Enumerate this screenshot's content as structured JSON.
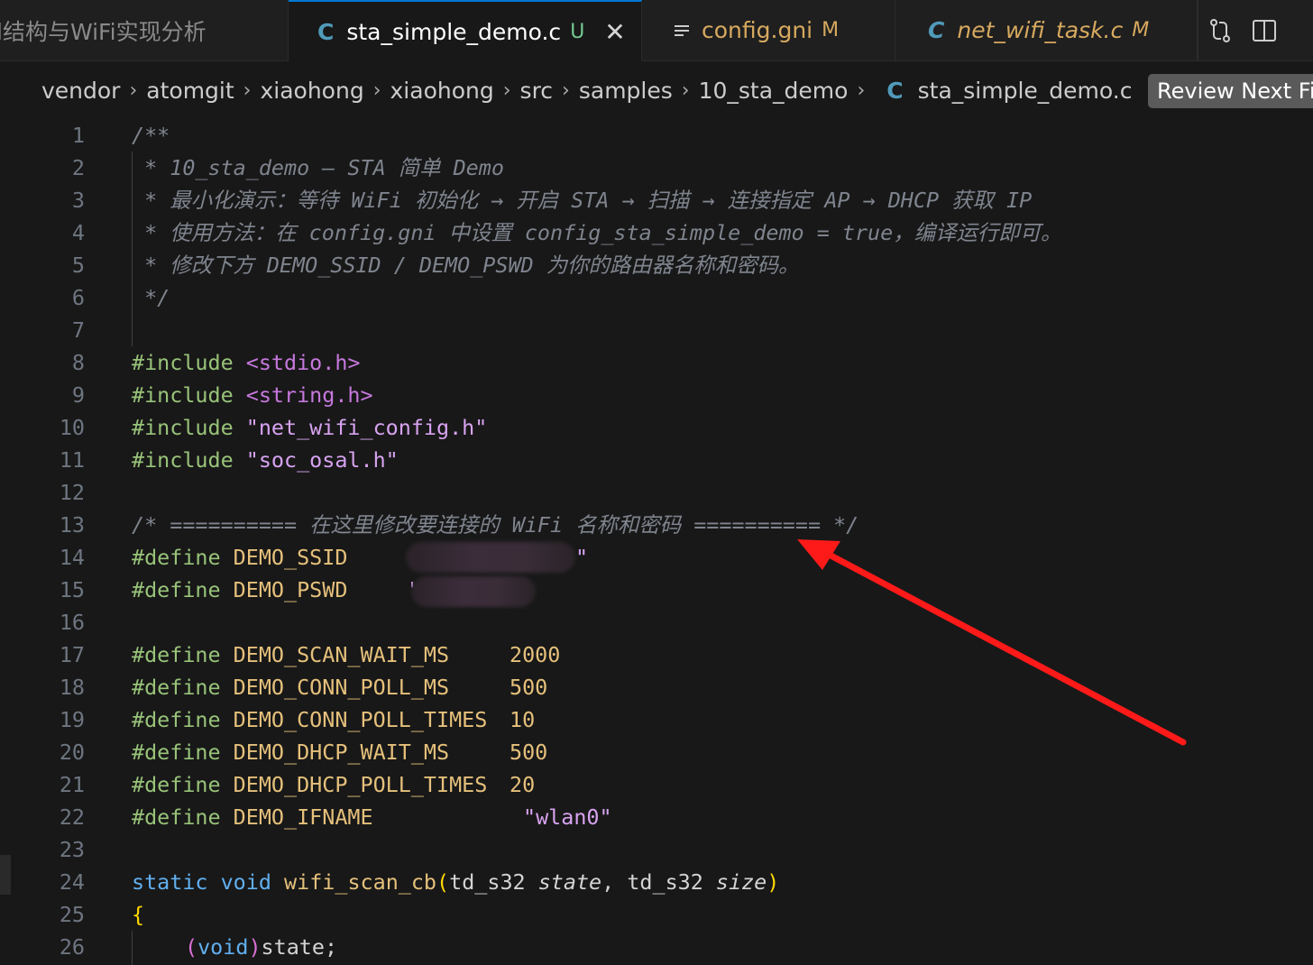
{
  "tabs": [
    {
      "label": "l结构与WiFi实现分析",
      "icon": "",
      "mark": ""
    },
    {
      "label": "sta_simple_demo.c",
      "icon": "C",
      "mark": "U",
      "close": "✕"
    },
    {
      "label": "config.gni",
      "icon": "lines-icon",
      "mark": "M"
    },
    {
      "label": "net_wifi_task.c",
      "icon": "C",
      "mark": "M"
    }
  ],
  "breadcrumb": {
    "items": [
      "vendor",
      "atomgit",
      "xiaohong",
      "xiaohong",
      "src",
      "samples",
      "10_sta_demo"
    ],
    "file_icon": "C",
    "file": "sta_simple_demo.c",
    "sep": "›"
  },
  "review_button": "Review Next File",
  "editor": {
    "line_numbers": [
      "1",
      "2",
      "3",
      "4",
      "5",
      "6",
      "7",
      "8",
      "9",
      "10",
      "11",
      "12",
      "13",
      "14",
      "15",
      "16",
      "17",
      "18",
      "19",
      "20",
      "21",
      "22",
      "23",
      "24",
      "25",
      "26"
    ],
    "comment": [
      "/**",
      " * 10_sta_demo — STA 简单 Demo",
      " * 最小化演示：等待 WiFi 初始化 → 开启 STA → 扫描 → 连接指定 AP → DHCP 获取 IP",
      " * 使用方法：在 config.gni 中设置 config_sta_simple_demo = true，编译运行即可。",
      " * 修改下方 DEMO_SSID / DEMO_PSWD 为你的路由器名称和密码。",
      " */"
    ],
    "includes": [
      {
        "kw": "#include",
        "file": "<stdio.h>"
      },
      {
        "kw": "#include",
        "file": "<string.h>"
      },
      {
        "kw": "#include",
        "file": "\"net_wifi_config.h\""
      },
      {
        "kw": "#include",
        "file": "\"soc_osal.h\""
      }
    ],
    "banner_comment": "/* ========== 在这里修改要连接的 WiFi 名称和密码 ========== */",
    "defines_secret": [
      {
        "kw": "#define",
        "name": "DEMO_SSID",
        "tail": "\""
      },
      {
        "kw": "#define",
        "name": "DEMO_PSWD",
        "tail": "'"
      }
    ],
    "defines": [
      {
        "kw": "#define",
        "name": "DEMO_SCAN_WAIT_MS",
        "value": "2000"
      },
      {
        "kw": "#define",
        "name": "DEMO_CONN_POLL_MS",
        "value": "500"
      },
      {
        "kw": "#define",
        "name": "DEMO_CONN_POLL_TIMES",
        "value": "10"
      },
      {
        "kw": "#define",
        "name": "DEMO_DHCP_WAIT_MS",
        "value": "500"
      },
      {
        "kw": "#define",
        "name": "DEMO_DHCP_POLL_TIMES",
        "value": "20"
      },
      {
        "kw": "#define",
        "name": "DEMO_IFNAME",
        "value": "\"wlan0\""
      }
    ],
    "func_sig": {
      "static": "static",
      "void": "void",
      "name": "wifi_scan_cb",
      "open": "(",
      "t1": "td_s32",
      "p1": "state",
      "comma": ",",
      "t2": "td_s32",
      "p2": "size",
      "close": ")"
    },
    "brace_open": "{",
    "line26": {
      "open": "(",
      "void": "void",
      "close": ")",
      "rest": "state;"
    }
  },
  "colors": {
    "arrow": "#ff1a1a",
    "accent": "#0078d4"
  }
}
